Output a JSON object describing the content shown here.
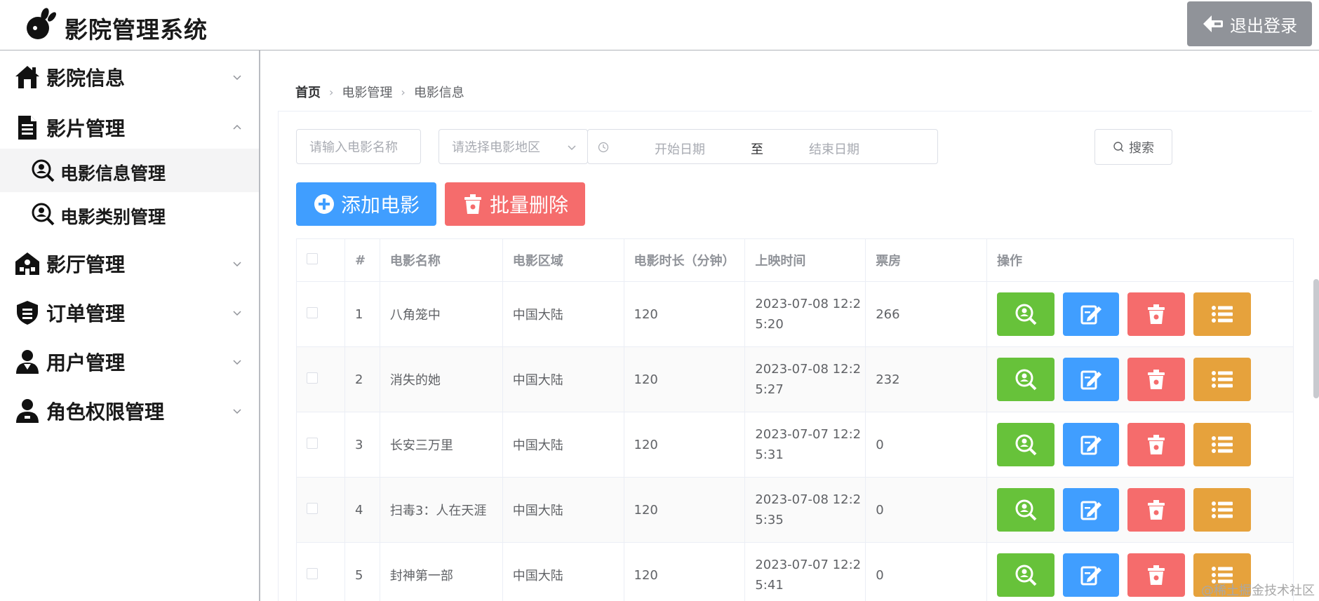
{
  "header": {
    "title": "影院管理系统",
    "logout_label": "退出登录"
  },
  "sidebar": {
    "items": [
      {
        "label": "影院信息",
        "icon": "home-icon",
        "expanded": false
      },
      {
        "label": "影片管理",
        "icon": "document-icon",
        "expanded": true,
        "children": [
          {
            "label": "电影信息管理",
            "icon": "search-user-icon",
            "active": true
          },
          {
            "label": "电影类别管理",
            "icon": "search-user-icon",
            "active": false
          }
        ]
      },
      {
        "label": "影厅管理",
        "icon": "building-icon",
        "expanded": false
      },
      {
        "label": "订单管理",
        "icon": "shield-list-icon",
        "expanded": false
      },
      {
        "label": "用户管理",
        "icon": "user-icon",
        "expanded": false
      },
      {
        "label": "角色权限管理",
        "icon": "user-role-icon",
        "expanded": false
      }
    ]
  },
  "breadcrumb": [
    "首页",
    "电影管理",
    "电影信息"
  ],
  "filters": {
    "name_placeholder": "请输入电影名称",
    "region_placeholder": "请选择电影地区",
    "start_placeholder": "开始日期",
    "range_separator": "至",
    "end_placeholder": "结束日期",
    "search_label": "搜索"
  },
  "actions": {
    "add_label": "添加电影",
    "batch_delete_label": "批量删除"
  },
  "table": {
    "columns": [
      "#",
      "电影名称",
      "电影区域",
      "电影时长（分钟）",
      "上映时间",
      "票房",
      "操作"
    ],
    "rows": [
      {
        "idx": "1",
        "name": "八角笼中",
        "region": "中国大陆",
        "duration": "120",
        "time_a": "2023-07-08 12:2",
        "time_b": "5:20",
        "box": "266"
      },
      {
        "idx": "2",
        "name": "消失的她",
        "region": "中国大陆",
        "duration": "120",
        "time_a": "2023-07-08 12:2",
        "time_b": "5:27",
        "box": "232"
      },
      {
        "idx": "3",
        "name": "长安三万里",
        "region": "中国大陆",
        "duration": "120",
        "time_a": "2023-07-07 12:2",
        "time_b": "5:31",
        "box": "0"
      },
      {
        "idx": "4",
        "name": "扫毒3：人在天涯",
        "region": "中国大陆",
        "duration": "120",
        "time_a": "2023-07-08 12:2",
        "time_b": "5:35",
        "box": "0"
      },
      {
        "idx": "5",
        "name": "封神第一部",
        "region": "中国大陆",
        "duration": "120",
        "time_a": "2023-07-07 12:2",
        "time_b": "5:41",
        "box": "0"
      }
    ]
  },
  "colors": {
    "primary": "#409eff",
    "success": "#67c23a",
    "danger": "#f56c6c",
    "warning": "#e6a23c",
    "info": "#909399"
  },
  "watermark": "@稀土掘金技术社区"
}
